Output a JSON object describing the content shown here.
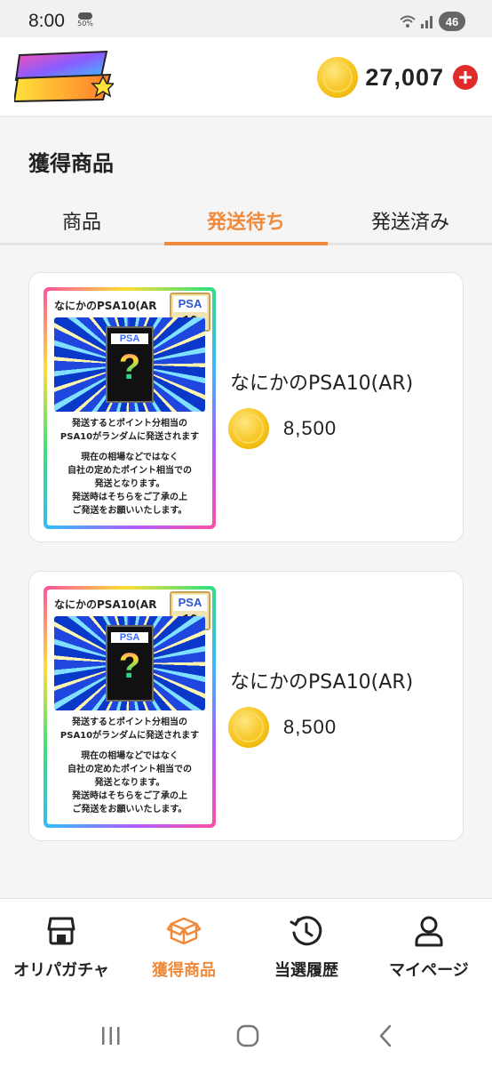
{
  "status_bar": {
    "time": "8:00",
    "weather_percent": "50%",
    "battery": "46"
  },
  "header": {
    "logo_alt": "オリパ スマッシュ",
    "points": "27,007"
  },
  "page": {
    "title": "獲得商品"
  },
  "tabs": [
    {
      "label": "商品",
      "active": false
    },
    {
      "label": "発送待ち",
      "active": true
    },
    {
      "label": "発送済み",
      "active": false
    }
  ],
  "products": [
    {
      "name": "なにかのPSA10(AR)",
      "price": "8,500",
      "image": {
        "title": "なにかのPSA10(AR",
        "psa_label": "PSA",
        "psa_grade": "10",
        "mystery_label": "PSA",
        "mystery_mark": "?",
        "lines_1": [
          "発送するとポイント分相当の",
          "PSA10がランダムに発送されます"
        ],
        "lines_2": [
          "現在の相場などではなく",
          "自社の定めたポイント相当での",
          "発送となります。",
          "発送時はそちらをご了承の上",
          "ご発送をお願いいたします。"
        ]
      }
    },
    {
      "name": "なにかのPSA10(AR)",
      "price": "8,500",
      "image": {
        "title": "なにかのPSA10(AR",
        "psa_label": "PSA",
        "psa_grade": "10",
        "mystery_label": "PSA",
        "mystery_mark": "?",
        "lines_1": [
          "発送するとポイント分相当の",
          "PSA10がランダムに発送されます"
        ],
        "lines_2": [
          "現在の相場などではなく",
          "自社の定めたポイント相当での",
          "発送となります。",
          "発送時はそちらをご了承の上",
          "ご発送をお願いいたします。"
        ]
      }
    }
  ],
  "bottom_nav": [
    {
      "label": "オリパガチャ",
      "icon": "store-icon",
      "active": false
    },
    {
      "label": "獲得商品",
      "icon": "box-icon",
      "active": true
    },
    {
      "label": "当選履歴",
      "icon": "history-icon",
      "active": false
    },
    {
      "label": "マイページ",
      "icon": "user-icon",
      "active": false
    }
  ],
  "colors": {
    "accent": "#f08a3c",
    "add_button": "#e02b2b",
    "coin": "#f6c218"
  }
}
